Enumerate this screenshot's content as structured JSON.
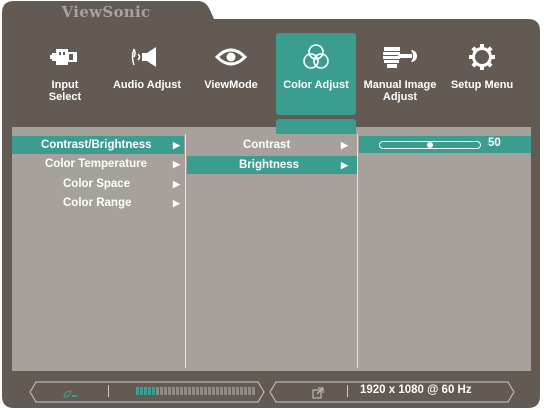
{
  "brand": "ViewSonic",
  "nav": [
    {
      "label": "Input\nSelect",
      "l1": "Input",
      "l2": "Select",
      "icon": "input-select-icon"
    },
    {
      "label": "Audio Adjust",
      "icon": "speaker-icon"
    },
    {
      "label": "ViewMode",
      "icon": "eye-icon"
    },
    {
      "label": "Color Adjust",
      "icon": "color-circles-icon",
      "active": true
    },
    {
      "label": "Manual Image Adjust",
      "l1": "Manual Image",
      "l2": "Adjust",
      "icon": "hand-wrench-icon"
    },
    {
      "label": "Setup Menu",
      "icon": "gear-icon"
    }
  ],
  "menu1": [
    {
      "label": "Contrast/Brightness",
      "selected": true
    },
    {
      "label": "Color Temperature"
    },
    {
      "label": "Color Space"
    },
    {
      "label": "Color Range"
    }
  ],
  "menu2": [
    {
      "label": "Contrast"
    },
    {
      "label": "Brightness",
      "selected": true
    }
  ],
  "slider": {
    "value": "50",
    "level": 50
  },
  "status": {
    "resolution": "1920 x 1080 @ 60 Hz",
    "signal_level_segments_on": 5
  },
  "colors": {
    "accent": "#3a9d8f",
    "frame": "#625a53",
    "panel": "#a7a19c"
  }
}
